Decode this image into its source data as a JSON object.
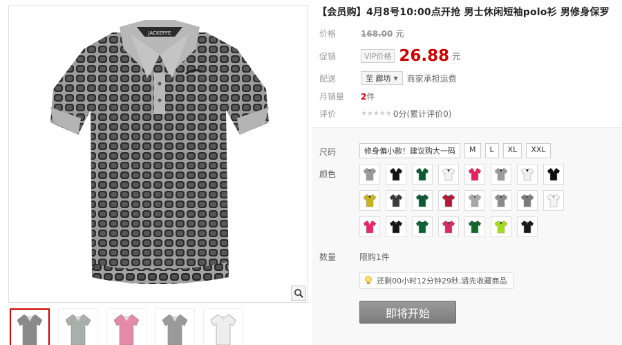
{
  "product": {
    "title": "【会员购】4月8号10:00点开抢 男士休闲短袖polo衫 男修身保罗",
    "shirt_brand_label": "JACKEFFE"
  },
  "pricing": {
    "price_label": "价格",
    "original_price": "168.00",
    "currency_unit": "元",
    "promo_label": "促销",
    "vip_badge": "VIP价格",
    "current_price": "26.88",
    "price_color": "#cc0000"
  },
  "shipping": {
    "label": "配送",
    "region": "至 廊坊",
    "note": "商家承担运费"
  },
  "sales": {
    "label": "月销量",
    "count": "2",
    "unit": "件"
  },
  "rating": {
    "label": "评价",
    "stars": "★★★★★",
    "text": "0分(累计评价0)"
  },
  "options": {
    "size_label": "尺码",
    "sizes": [
      "修身偏小款！建议购大一码",
      "M",
      "L",
      "XL",
      "XXL"
    ],
    "color_label": "颜色",
    "swatches": [
      {
        "body": "#9a9a9a",
        "accent": "#666666"
      },
      {
        "body": "#111111",
        "accent": "#ffffff"
      },
      {
        "body": "#0f5a34",
        "accent": "#ffffff"
      },
      {
        "body": "#f2f2f2",
        "accent": "#333333"
      },
      {
        "body": "#e0245e",
        "accent": "#ffffff"
      },
      {
        "body": "#9a9a9a",
        "accent": "#333333"
      },
      {
        "body": "#f0f0f0",
        "accent": "#111111"
      },
      {
        "body": "#111111",
        "accent": "#dddddd"
      },
      {
        "body": "#c9b21c",
        "accent": "#333333"
      },
      {
        "body": "#3a3a3a",
        "accent": "#888888"
      },
      {
        "body": "#0f5a34",
        "accent": "#444444"
      },
      {
        "body": "#b5183a",
        "accent": "#444444"
      },
      {
        "body": "#a8a8a8",
        "accent": "#555555"
      },
      {
        "body": "#8c8c8c",
        "accent": "#444444"
      },
      {
        "body": "#7a7a7a",
        "accent": "#444444"
      },
      {
        "body": "#f4f4f4",
        "accent": "#999999"
      },
      {
        "body": "#e8266a",
        "accent": "#ffffff"
      },
      {
        "body": "#141414",
        "accent": "#555555"
      },
      {
        "body": "#0d6332",
        "accent": "#444444"
      },
      {
        "body": "#d82a64",
        "accent": "#444444"
      },
      {
        "body": "#13672f",
        "accent": "#444444"
      },
      {
        "body": "#a5dc1e",
        "accent": "#444444"
      },
      {
        "body": "#1a1a1a",
        "accent": "#666666"
      }
    ],
    "quantity_label": "数量",
    "limit_text": "限购1件",
    "countdown_text": "还剩00小时12分钟29秒,请先收藏商品",
    "buy_button": "即将开始"
  },
  "gallery": {
    "thumbnails": [
      {
        "color": "#8a8a8a",
        "active": true
      },
      {
        "color": "#a9b0ab",
        "active": false
      },
      {
        "color": "#e48aa9",
        "active": false
      },
      {
        "color": "#9a9a9a",
        "active": false
      },
      {
        "color": "#eeeeee",
        "active": false
      }
    ]
  }
}
